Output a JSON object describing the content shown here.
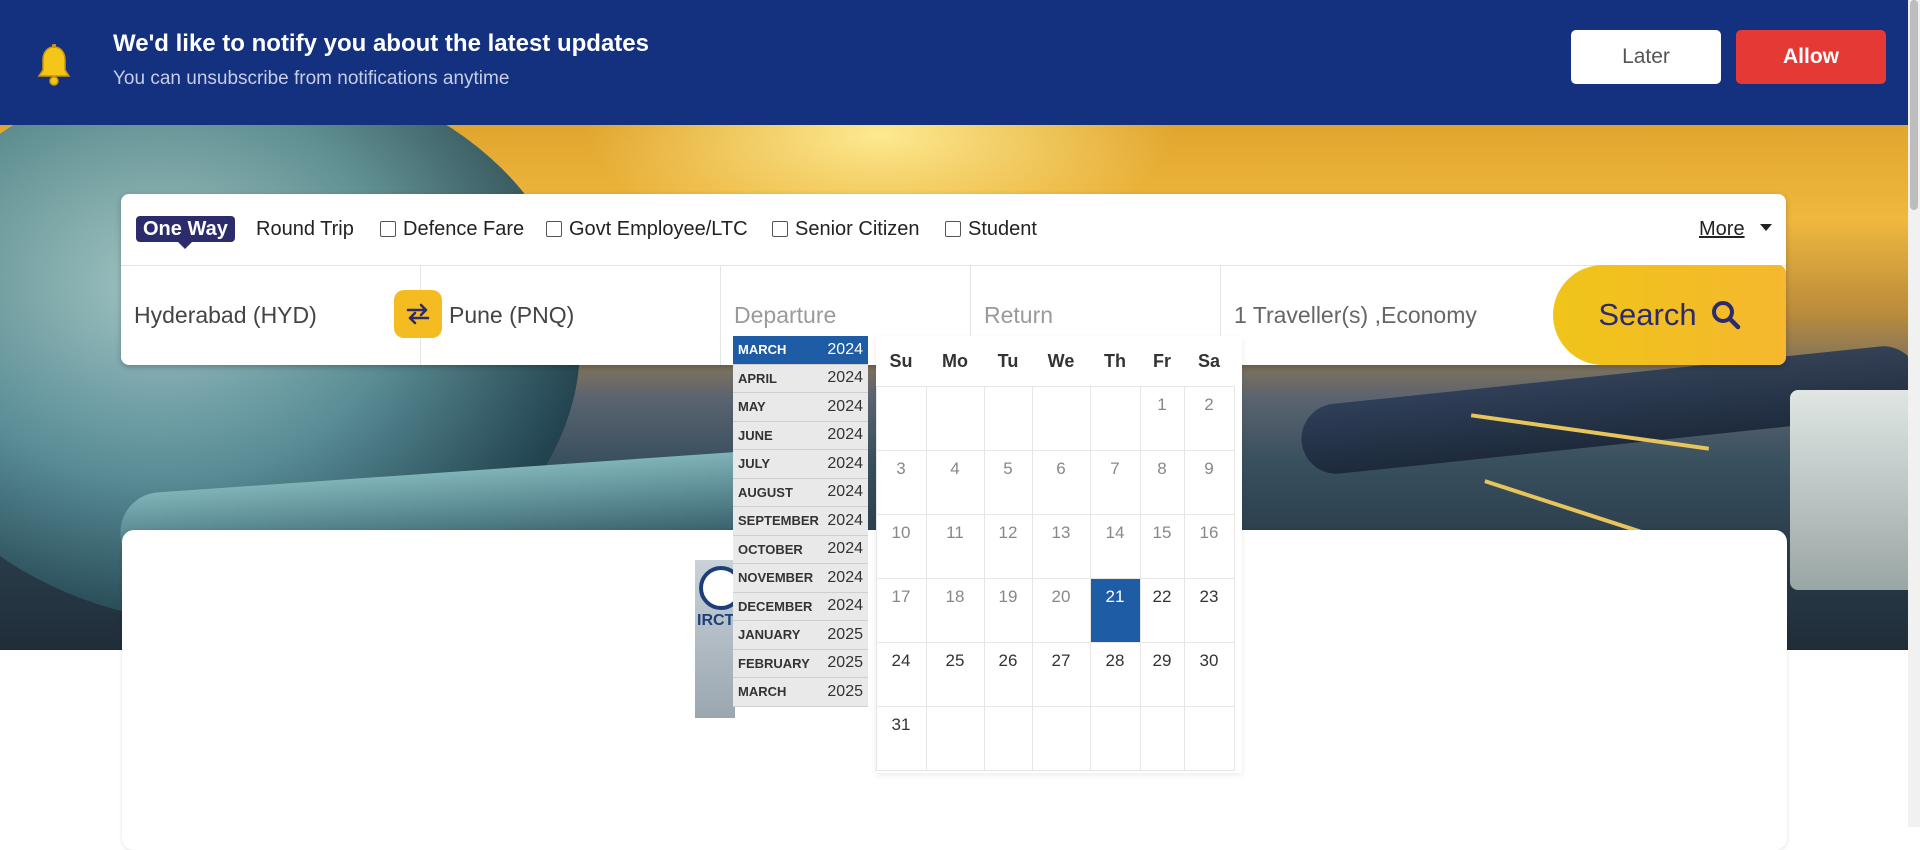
{
  "notification": {
    "title": "We'd like to notify you about the latest updates",
    "subtitle": "You can unsubscribe from notifications anytime",
    "later_label": "Later",
    "allow_label": "Allow"
  },
  "trip_types": {
    "one_way": "One Way",
    "round_trip": "Round Trip",
    "options": [
      "Defence Fare",
      "Govt Employee/LTC",
      "Senior Citizen",
      "Student"
    ],
    "more": "More"
  },
  "fields": {
    "from": "Hyderabad (HYD)",
    "to": "Pune (PNQ)",
    "departure_placeholder": "Departure",
    "return_placeholder": "Return",
    "travellers": "1 Traveller(s) ,Economy",
    "search_label": "Search"
  },
  "irctc_text": "IRCT",
  "months": [
    {
      "name": "MARCH",
      "year": "2024"
    },
    {
      "name": "APRIL",
      "year": "2024"
    },
    {
      "name": "MAY",
      "year": "2024"
    },
    {
      "name": "JUNE",
      "year": "2024"
    },
    {
      "name": "JULY",
      "year": "2024"
    },
    {
      "name": "AUGUST",
      "year": "2024"
    },
    {
      "name": "SEPTEMBER",
      "year": "2024"
    },
    {
      "name": "OCTOBER",
      "year": "2024"
    },
    {
      "name": "NOVEMBER",
      "year": "2024"
    },
    {
      "name": "DECEMBER",
      "year": "2024"
    },
    {
      "name": "JANUARY",
      "year": "2025"
    },
    {
      "name": "FEBRUARY",
      "year": "2025"
    },
    {
      "name": "MARCH",
      "year": "2025"
    }
  ],
  "active_month_index": 0,
  "calendar": {
    "weekdays": [
      "Su",
      "Mo",
      "Tu",
      "We",
      "Th",
      "Fr",
      "Sa"
    ],
    "weeks": [
      [
        "",
        "",
        "",
        "",
        "",
        "1",
        "2"
      ],
      [
        "3",
        "4",
        "5",
        "6",
        "7",
        "8",
        "9"
      ],
      [
        "10",
        "11",
        "12",
        "13",
        "14",
        "15",
        "16"
      ],
      [
        "17",
        "18",
        "19",
        "20",
        "21",
        "22",
        "23"
      ],
      [
        "24",
        "25",
        "26",
        "27",
        "28",
        "29",
        "30"
      ],
      [
        "31",
        "",
        "",
        "",
        "",
        "",
        ""
      ]
    ],
    "selected_day": "21"
  },
  "colors": {
    "banner": "#13317f",
    "allow": "#e53935",
    "selected": "#1f5ca6",
    "accent": "#f5bc22",
    "brand": "#2c2c6c"
  }
}
